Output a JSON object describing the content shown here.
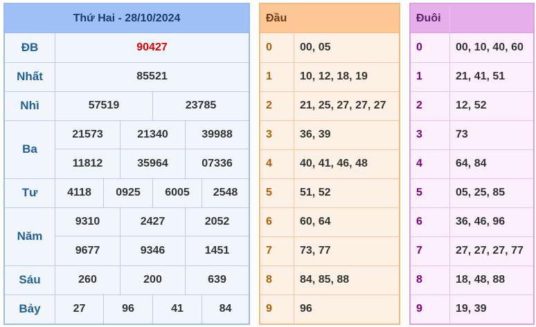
{
  "main": {
    "title": "Thứ Hai - 28/10/2024",
    "db": {
      "label": "ĐB",
      "values": [
        "90427"
      ]
    },
    "nhat": {
      "label": "Nhất",
      "values": [
        "85521"
      ]
    },
    "nhi": {
      "label": "Nhì",
      "values": [
        "57519",
        "23785"
      ]
    },
    "ba": {
      "label": "Ba",
      "values": [
        "21573",
        "21340",
        "39988",
        "11812",
        "35964",
        "07336"
      ]
    },
    "tu": {
      "label": "Tư",
      "values": [
        "4118",
        "0925",
        "6005",
        "2548"
      ]
    },
    "nam": {
      "label": "Năm",
      "values": [
        "9310",
        "2427",
        "2052",
        "9677",
        "9346",
        "1451"
      ]
    },
    "sau": {
      "label": "Sáu",
      "values": [
        "260",
        "200",
        "639"
      ]
    },
    "bay": {
      "label": "Bảy",
      "values": [
        "27",
        "96",
        "41",
        "84"
      ]
    }
  },
  "dau": {
    "header": "Đầu",
    "rows": [
      {
        "key": "0",
        "values": "00, 05"
      },
      {
        "key": "1",
        "values": "10, 12, 18, 19"
      },
      {
        "key": "2",
        "values": "21, 25, 27, 27, 27"
      },
      {
        "key": "3",
        "values": "36, 39"
      },
      {
        "key": "4",
        "values": "40, 41, 46, 48"
      },
      {
        "key": "5",
        "values": "51, 52"
      },
      {
        "key": "6",
        "values": "60, 64"
      },
      {
        "key": "7",
        "values": "73, 77"
      },
      {
        "key": "8",
        "values": "84, 85, 88"
      },
      {
        "key": "9",
        "values": "96"
      }
    ]
  },
  "duoi": {
    "header": "Đuôi",
    "rows": [
      {
        "key": "0",
        "values": "00, 10, 40, 60"
      },
      {
        "key": "1",
        "values": "21, 41, 51"
      },
      {
        "key": "2",
        "values": "12, 52"
      },
      {
        "key": "3",
        "values": "73"
      },
      {
        "key": "4",
        "values": "64, 84"
      },
      {
        "key": "5",
        "values": "05, 25, 85"
      },
      {
        "key": "6",
        "values": "36, 46, 96"
      },
      {
        "key": "7",
        "values": "27, 27, 27, 77"
      },
      {
        "key": "8",
        "values": "18, 48, 88"
      },
      {
        "key": "9",
        "values": "19, 39"
      }
    ]
  }
}
